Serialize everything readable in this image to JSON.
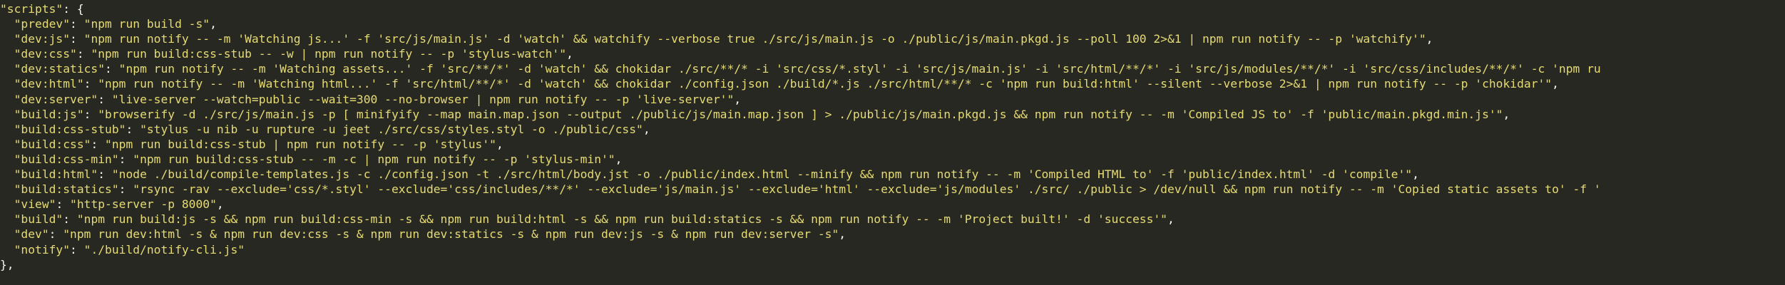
{
  "editor": {
    "colors": {
      "background": "#272822",
      "string": "#e6db74",
      "punctuation": "#f8f8f2"
    },
    "lines": [
      {
        "indent": "",
        "key": "\"scripts\"",
        "sep": ": ",
        "value": "",
        "tail": "{"
      },
      {
        "indent": "  ",
        "key": "\"predev\"",
        "sep": ": ",
        "value": "\"npm run build -s\"",
        "tail": ","
      },
      {
        "indent": "  ",
        "key": "\"dev:js\"",
        "sep": ": ",
        "value": "\"npm run notify -- -m 'Watching js...' -f 'src/js/main.js' -d 'watch' && watchify --verbose true ./src/js/main.js -o ./public/js/main.pkgd.js --poll 100 2>&1 | npm run notify -- -p 'watchify'\"",
        "tail": ","
      },
      {
        "indent": "  ",
        "key": "\"dev:css\"",
        "sep": ": ",
        "value": "\"npm run build:css-stub -- -w | npm run notify -- -p 'stylus-watch'\"",
        "tail": ","
      },
      {
        "indent": "  ",
        "key": "\"dev:statics\"",
        "sep": ": ",
        "value": "\"npm run notify -- -m 'Watching assets...' -f 'src/**/*' -d 'watch' && chokidar ./src/**/* -i 'src/css/*.styl' -i 'src/js/main.js' -i 'src/html/**/*' -i 'src/js/modules/**/*' -i 'src/css/includes/**/*' -c 'npm ru",
        "tail": ""
      },
      {
        "indent": "  ",
        "key": "\"dev:html\"",
        "sep": ": ",
        "value": "\"npm run notify -- -m 'Watching html...' -f 'src/html/**/*' -d 'watch' && chokidar ./config.json ./build/*.js ./src/html/**/* -c 'npm run build:html' --silent --verbose 2>&1 | npm run notify -- -p 'chokidar'\"",
        "tail": ","
      },
      {
        "indent": "  ",
        "key": "\"dev:server\"",
        "sep": ": ",
        "value": "\"live-server --watch=public --wait=300 --no-browser | npm run notify -- -p 'live-server'\"",
        "tail": ","
      },
      {
        "indent": "  ",
        "key": "\"build:js\"",
        "sep": ": ",
        "value": "\"browserify -d ./src/js/main.js -p [ minifyify --map main.map.json --output ./public/js/main.map.json ] > ./public/js/main.pkgd.js && npm run notify -- -m 'Compiled JS to' -f 'public/main.pkgd.min.js'\"",
        "tail": ","
      },
      {
        "indent": "  ",
        "key": "\"build:css-stub\"",
        "sep": ": ",
        "value": "\"stylus -u nib -u rupture -u jeet ./src/css/styles.styl -o ./public/css\"",
        "tail": ","
      },
      {
        "indent": "  ",
        "key": "\"build:css\"",
        "sep": ": ",
        "value": "\"npm run build:css-stub | npm run notify -- -p 'stylus'\"",
        "tail": ","
      },
      {
        "indent": "  ",
        "key": "\"build:css-min\"",
        "sep": ": ",
        "value": "\"npm run build:css-stub -- -m -c | npm run notify -- -p 'stylus-min'\"",
        "tail": ","
      },
      {
        "indent": "  ",
        "key": "\"build:html\"",
        "sep": ": ",
        "value": "\"node ./build/compile-templates.js -c ./config.json -t ./src/html/body.jst -o ./public/index.html --minify && npm run notify -- -m 'Compiled HTML to' -f 'public/index.html' -d 'compile'\"",
        "tail": ","
      },
      {
        "indent": "  ",
        "key": "\"build:statics\"",
        "sep": ": ",
        "value": "\"rsync -rav --exclude='css/*.styl' --exclude='css/includes/**/*' --exclude='js/main.js' --exclude='html' --exclude='js/modules' ./src/ ./public > /dev/null && npm run notify -- -m 'Copied static assets to' -f '",
        "tail": ""
      },
      {
        "indent": "  ",
        "key": "\"view\"",
        "sep": ": ",
        "value": "\"http-server -p 8000\"",
        "tail": ","
      },
      {
        "indent": "  ",
        "key": "\"build\"",
        "sep": ": ",
        "value": "\"npm run build:js -s && npm run build:css-min -s && npm run build:html -s && npm run build:statics -s && npm run notify -- -m 'Project built!' -d 'success'\"",
        "tail": ","
      },
      {
        "indent": "  ",
        "key": "\"dev\"",
        "sep": ": ",
        "value": "\"npm run dev:html -s & npm run dev:css -s & npm run dev:statics -s & npm run dev:js -s & npm run dev:server -s\"",
        "tail": ","
      },
      {
        "indent": "  ",
        "key": "\"notify\"",
        "sep": ": ",
        "value": "\"./build/notify-cli.js\"",
        "tail": ""
      },
      {
        "indent": "",
        "key": "",
        "sep": "",
        "value": "",
        "tail": "},"
      }
    ]
  }
}
